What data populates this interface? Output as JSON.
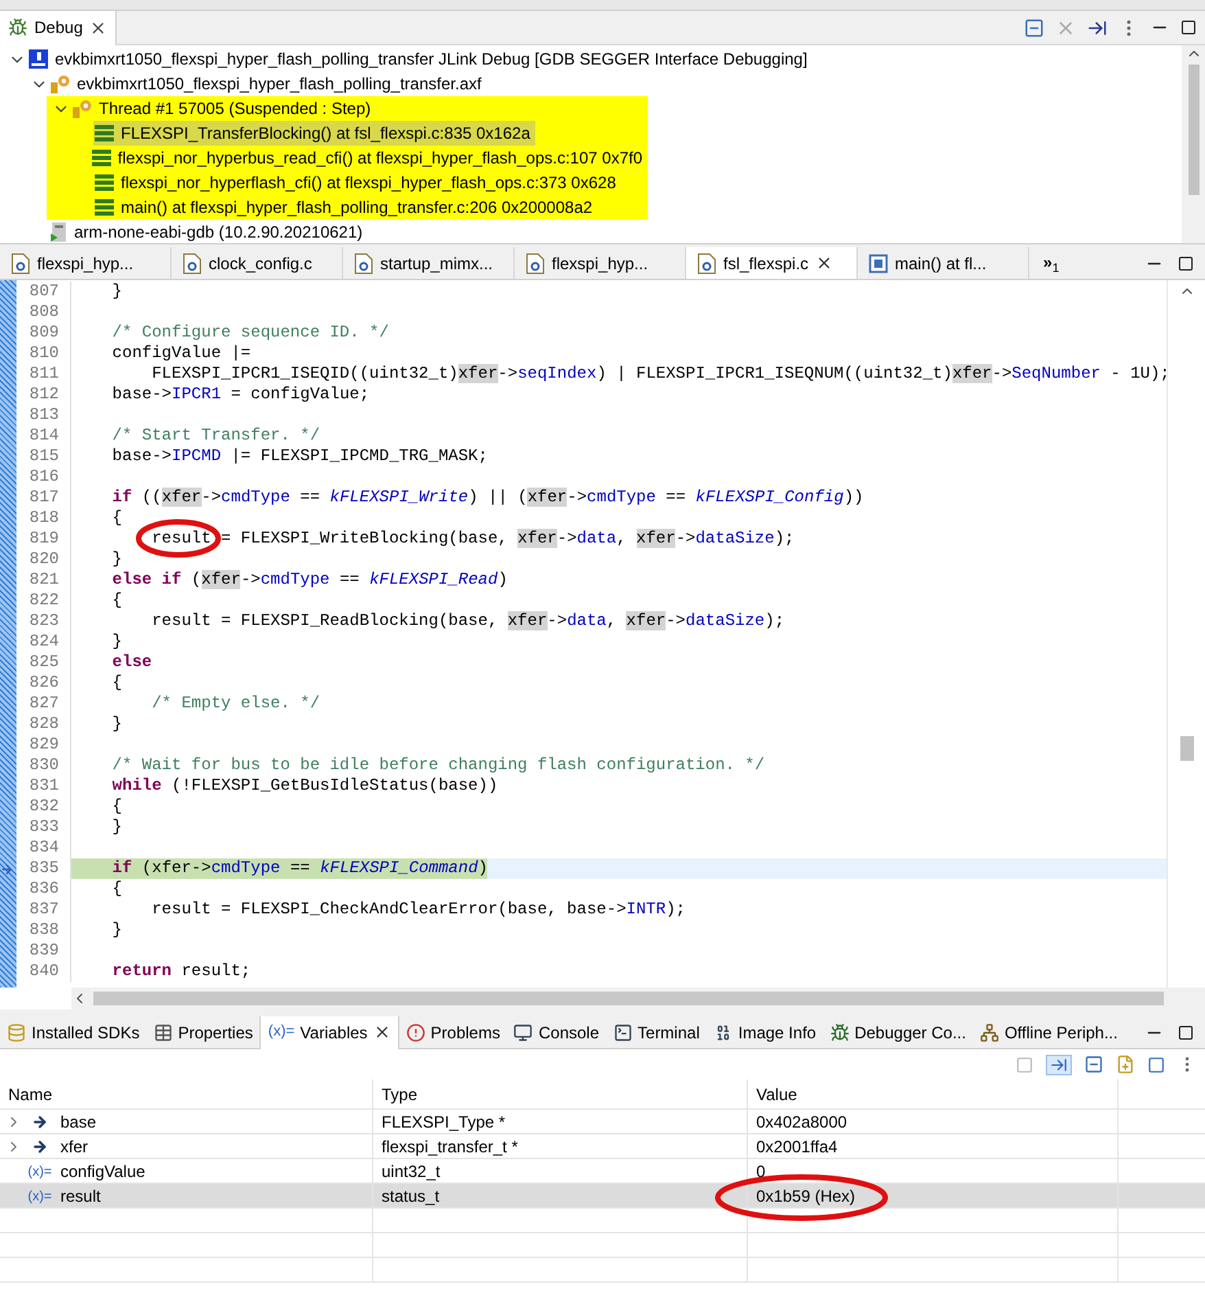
{
  "debug_view": {
    "tab": {
      "label": "Debug",
      "selected": true
    },
    "tree": [
      {
        "kind": "launch",
        "label": "evkbimxrt1050_flexspi_hyper_flash_polling_transfer JLink Debug [GDB SEGGER Interface Debugging]",
        "expanded": true,
        "highlighted": false,
        "children": [
          {
            "kind": "process",
            "label": "evkbimxrt1050_flexspi_hyper_flash_polling_transfer.axf",
            "expanded": true,
            "highlighted": false,
            "children": [
              {
                "kind": "thread",
                "label": "Thread #1 57005 (Suspended : Step)",
                "expanded": true,
                "highlighted": true,
                "children": [
                  {
                    "kind": "frame",
                    "label": "FLEXSPI_TransferBlocking() at fsl_flexspi.c:835 0x162a",
                    "selected": true
                  },
                  {
                    "kind": "frame",
                    "label": "flexspi_nor_hyperbus_read_cfi() at flexspi_hyper_flash_ops.c:107 0x7f0",
                    "selected": false
                  },
                  {
                    "kind": "frame",
                    "label": "flexspi_nor_hyperflash_cfi() at flexspi_hyper_flash_ops.c:373 0x628",
                    "selected": false
                  },
                  {
                    "kind": "frame",
                    "label": "main() at flexspi_hyper_flash_polling_transfer.c:206 0x200008a2",
                    "selected": false
                  }
                ]
              }
            ]
          },
          {
            "kind": "gdb",
            "label": "arm-none-eabi-gdb (10.2.90.20210621)",
            "highlighted": false
          }
        ]
      }
    ]
  },
  "editor": {
    "tabs": [
      {
        "label": "flexspi_hyp...",
        "kind": "c",
        "selected": false
      },
      {
        "label": "clock_config.c",
        "kind": "c",
        "selected": false
      },
      {
        "label": "startup_mimx...",
        "kind": "c",
        "selected": false
      },
      {
        "label": "flexspi_hyp...",
        "kind": "c",
        "selected": false
      },
      {
        "label": "fsl_flexspi.c",
        "kind": "c",
        "selected": true
      },
      {
        "label": "main() at fl...",
        "kind": "disasm",
        "selected": false
      }
    ],
    "overflow": "»",
    "overflow_count": "1",
    "lines": [
      {
        "number": "807",
        "current": false,
        "annotated": false,
        "tokens": [
          {
            "t": "    }",
            "kind": "plain"
          }
        ]
      },
      {
        "number": "808",
        "current": false,
        "annotated": false
      },
      {
        "number": "809",
        "current": false,
        "annotated": false,
        "tokens": [
          {
            "t": "    /* Configure sequence ID. */",
            "kind": "comment"
          }
        ]
      },
      {
        "number": "810",
        "current": false,
        "annotated": false,
        "tokens": [
          {
            "t": "    configValue |=",
            "kind": "plain"
          }
        ]
      },
      {
        "number": "811",
        "current": false,
        "annotated": false,
        "tokens": [
          {
            "t": "        FLEXSPI_IPCR1_ISEQID((uint32_t)",
            "kind": "plain"
          },
          {
            "t": "xfer",
            "kind": "variable"
          },
          {
            "t": "->",
            "kind": "plain"
          },
          {
            "t": "seqIndex",
            "kind": "field"
          },
          {
            "t": ") | FLEXSPI_IPCR1_ISEQNUM((uint32_t)",
            "kind": "plain"
          },
          {
            "t": "xfer",
            "kind": "variable"
          },
          {
            "t": "->",
            "kind": "plain"
          },
          {
            "t": "SeqNumber",
            "kind": "field"
          },
          {
            "t": " - 1U);",
            "kind": "plain"
          }
        ]
      },
      {
        "number": "812",
        "current": false,
        "annotated": false,
        "tokens": [
          {
            "t": "    base->",
            "kind": "plain"
          },
          {
            "t": "IPCR1",
            "kind": "field"
          },
          {
            "t": " = configValue;",
            "kind": "plain"
          }
        ]
      },
      {
        "number": "813",
        "current": false,
        "annotated": false
      },
      {
        "number": "814",
        "current": false,
        "annotated": false,
        "tokens": [
          {
            "t": "    /* Start Transfer. */",
            "kind": "comment"
          }
        ]
      },
      {
        "number": "815",
        "current": false,
        "annotated": false,
        "tokens": [
          {
            "t": "    base->",
            "kind": "plain"
          },
          {
            "t": "IPCMD",
            "kind": "field"
          },
          {
            "t": " |= FLEXSPI_IPCMD_TRG_MASK;",
            "kind": "plain"
          }
        ]
      },
      {
        "number": "816",
        "current": false,
        "annotated": false
      },
      {
        "number": "817",
        "current": false,
        "annotated": false,
        "tokens": [
          {
            "t": "    if",
            "kind": "keyword"
          },
          {
            "t": " ((",
            "kind": "plain"
          },
          {
            "t": "xfer",
            "kind": "variable"
          },
          {
            "t": "->",
            "kind": "plain"
          },
          {
            "t": "cmdType",
            "kind": "field"
          },
          {
            "t": " == ",
            "kind": "plain"
          },
          {
            "t": "kFLEXSPI_Write",
            "kind": "enum"
          },
          {
            "t": ") || (",
            "kind": "plain"
          },
          {
            "t": "xfer",
            "kind": "variable"
          },
          {
            "t": "->",
            "kind": "plain"
          },
          {
            "t": "cmdType",
            "kind": "field"
          },
          {
            "t": " == ",
            "kind": "plain"
          },
          {
            "t": "kFLEXSPI_Config",
            "kind": "enum"
          },
          {
            "t": "))",
            "kind": "plain"
          }
        ]
      },
      {
        "number": "818",
        "current": false,
        "annotated": false,
        "tokens": [
          {
            "t": "    {",
            "kind": "plain"
          }
        ]
      },
      {
        "number": "819",
        "current": false,
        "annotated": true,
        "tokens": [
          {
            "t": "        result = FLEXSPI_WriteBlocking(base, ",
            "kind": "plain"
          },
          {
            "t": "xfer",
            "kind": "variable"
          },
          {
            "t": "->",
            "kind": "plain"
          },
          {
            "t": "data",
            "kind": "field"
          },
          {
            "t": ", ",
            "kind": "plain"
          },
          {
            "t": "xfer",
            "kind": "variable"
          },
          {
            "t": "->",
            "kind": "plain"
          },
          {
            "t": "dataSize",
            "kind": "field"
          },
          {
            "t": ");",
            "kind": "plain"
          }
        ]
      },
      {
        "number": "820",
        "current": false,
        "annotated": false,
        "tokens": [
          {
            "t": "    }",
            "kind": "plain"
          }
        ]
      },
      {
        "number": "821",
        "current": false,
        "annotated": false,
        "tokens": [
          {
            "t": "    else if",
            "kind": "keyword"
          },
          {
            "t": " (",
            "kind": "plain"
          },
          {
            "t": "xfer",
            "kind": "variable"
          },
          {
            "t": "->",
            "kind": "plain"
          },
          {
            "t": "cmdType",
            "kind": "field"
          },
          {
            "t": " == ",
            "kind": "plain"
          },
          {
            "t": "kFLEXSPI_Read",
            "kind": "enum"
          },
          {
            "t": ")",
            "kind": "plain"
          }
        ]
      },
      {
        "number": "822",
        "current": false,
        "annotated": false,
        "tokens": [
          {
            "t": "    {",
            "kind": "plain"
          }
        ]
      },
      {
        "number": "823",
        "current": false,
        "annotated": false,
        "tokens": [
          {
            "t": "        result = FLEXSPI_ReadBlocking(base, ",
            "kind": "plain"
          },
          {
            "t": "xfer",
            "kind": "variable"
          },
          {
            "t": "->",
            "kind": "plain"
          },
          {
            "t": "data",
            "kind": "field"
          },
          {
            "t": ", ",
            "kind": "plain"
          },
          {
            "t": "xfer",
            "kind": "variable"
          },
          {
            "t": "->",
            "kind": "plain"
          },
          {
            "t": "dataSize",
            "kind": "field"
          },
          {
            "t": ");",
            "kind": "plain"
          }
        ]
      },
      {
        "number": "824",
        "current": false,
        "annotated": false,
        "tokens": [
          {
            "t": "    }",
            "kind": "plain"
          }
        ]
      },
      {
        "number": "825",
        "current": false,
        "annotated": false,
        "tokens": [
          {
            "t": "    else",
            "kind": "keyword"
          }
        ]
      },
      {
        "number": "826",
        "current": false,
        "annotated": false,
        "tokens": [
          {
            "t": "    {",
            "kind": "plain"
          }
        ]
      },
      {
        "number": "827",
        "current": false,
        "annotated": false,
        "tokens": [
          {
            "t": "        /* Empty else. */",
            "kind": "comment"
          }
        ]
      },
      {
        "number": "828",
        "current": false,
        "annotated": false,
        "tokens": [
          {
            "t": "    }",
            "kind": "plain"
          }
        ]
      },
      {
        "number": "829",
        "current": false,
        "annotated": false
      },
      {
        "number": "830",
        "current": false,
        "annotated": false,
        "tokens": [
          {
            "t": "    /* Wait for bus to be idle before changing flash configuration. */",
            "kind": "comment"
          }
        ]
      },
      {
        "number": "831",
        "current": false,
        "annotated": false,
        "tokens": [
          {
            "t": "    while",
            "kind": "keyword"
          },
          {
            "t": " (!FLEXSPI_GetBusIdleStatus(base))",
            "kind": "plain"
          }
        ]
      },
      {
        "number": "832",
        "current": false,
        "annotated": false,
        "tokens": [
          {
            "t": "    {",
            "kind": "plain"
          }
        ]
      },
      {
        "number": "833",
        "current": false,
        "annotated": false,
        "tokens": [
          {
            "t": "    }",
            "kind": "plain"
          }
        ]
      },
      {
        "number": "834",
        "current": false,
        "annotated": false
      },
      {
        "number": "835",
        "current": true,
        "annotated": false,
        "tokens": [
          {
            "t": "    if",
            "kind": "keyword"
          },
          {
            "t": " (xfer->",
            "kind": "plain"
          },
          {
            "t": "cmdType",
            "kind": "field"
          },
          {
            "t": " == ",
            "kind": "plain"
          },
          {
            "t": "kFLEXSPI_Command",
            "kind": "enum"
          },
          {
            "t": ")",
            "kind": "plain"
          }
        ]
      },
      {
        "number": "836",
        "current": false,
        "annotated": false,
        "tokens": [
          {
            "t": "    {",
            "kind": "plain"
          }
        ]
      },
      {
        "number": "837",
        "current": false,
        "annotated": false,
        "tokens": [
          {
            "t": "        result = FLEXSPI_CheckAndClearError(base, base->",
            "kind": "plain"
          },
          {
            "t": "INTR",
            "kind": "field"
          },
          {
            "t": ");",
            "kind": "plain"
          }
        ]
      },
      {
        "number": "838",
        "current": false,
        "annotated": false,
        "tokens": [
          {
            "t": "    }",
            "kind": "plain"
          }
        ]
      },
      {
        "number": "839",
        "current": false,
        "annotated": false
      },
      {
        "number": "840",
        "current": false,
        "annotated": false,
        "tokens": [
          {
            "t": "    return",
            "kind": "keyword"
          },
          {
            "t": " result;",
            "kind": "plain"
          }
        ]
      }
    ]
  },
  "bottom_panel": {
    "tabs": [
      {
        "label": "Installed SDKs",
        "kind": "sdk",
        "selected": false
      },
      {
        "label": "Properties",
        "kind": "properties",
        "selected": false
      },
      {
        "label": "Variables",
        "kind": "variables",
        "icon_text": "(x)=",
        "selected": true
      },
      {
        "label": "Problems",
        "kind": "problems",
        "selected": false
      },
      {
        "label": "Console",
        "kind": "console",
        "selected": false
      },
      {
        "label": "Terminal",
        "kind": "terminal",
        "selected": false
      },
      {
        "label": "Image Info",
        "kind": "image",
        "selected": false
      },
      {
        "label": "Debugger Co...",
        "kind": "debugger",
        "selected": false
      },
      {
        "label": "Offline Periph...",
        "kind": "peripherals",
        "selected": false
      }
    ],
    "table": {
      "columns": [
        "Name",
        "Type",
        "Value"
      ],
      "rows": [
        {
          "name": "base",
          "type": "FLEXSPI_Type *",
          "value": "0x402a8000",
          "kind": "pointer",
          "expandable": true,
          "selected": false,
          "annotated": false
        },
        {
          "name": "xfer",
          "type": "flexspi_transfer_t *",
          "value": "0x2001ffa4",
          "kind": "pointer",
          "expandable": true,
          "selected": false,
          "annotated": false
        },
        {
          "name": "configValue",
          "type": "uint32_t",
          "value": "0",
          "kind": "variable",
          "icon_text": "(x)=",
          "expandable": false,
          "selected": false,
          "annotated": false
        },
        {
          "name": "result",
          "type": "status_t",
          "value": "0x1b59 (Hex)",
          "kind": "variable",
          "icon_text": "(x)=",
          "expandable": false,
          "selected": true,
          "annotated": true
        }
      ]
    }
  }
}
